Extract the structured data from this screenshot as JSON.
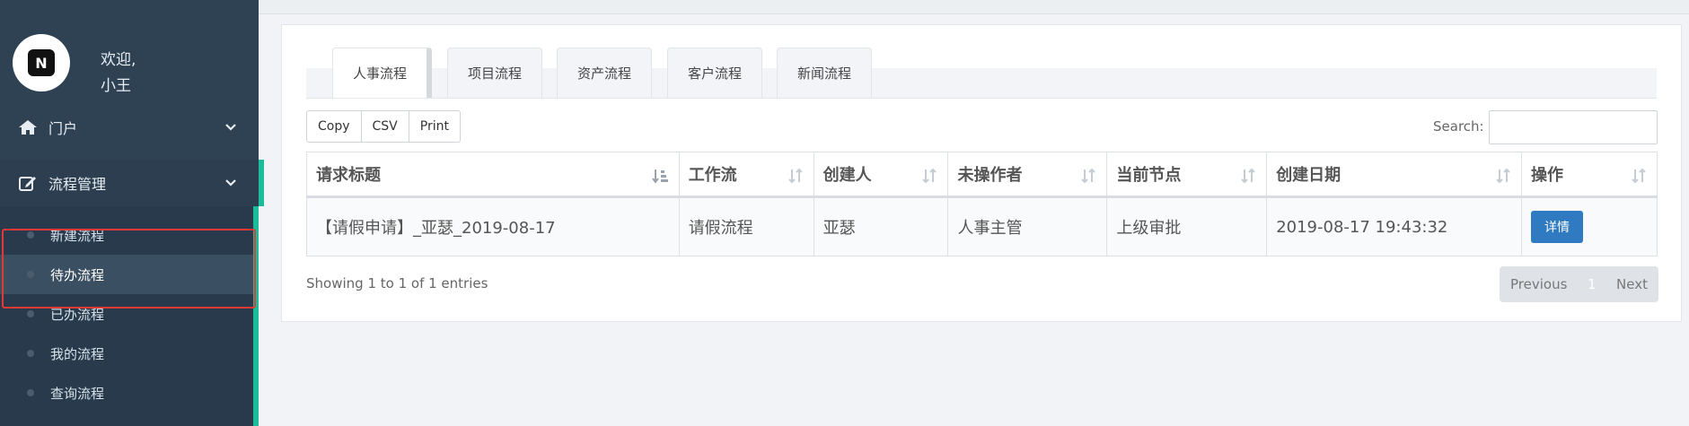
{
  "sidebar": {
    "welcome": "欢迎,",
    "username": "小王",
    "avatar_letter": "N",
    "portal": {
      "label": "门户",
      "icon": "home-icon"
    },
    "flow_mgmt": {
      "label": "流程管理",
      "icon": "edit-icon"
    },
    "sub_items": [
      {
        "label": "新建流程"
      },
      {
        "label": "待办流程",
        "active": true
      },
      {
        "label": "已办流程"
      },
      {
        "label": "我的流程"
      },
      {
        "label": "查询流程"
      }
    ]
  },
  "tabs": [
    {
      "label": "人事流程",
      "active": true
    },
    {
      "label": "项目流程"
    },
    {
      "label": "资产流程"
    },
    {
      "label": "客户流程"
    },
    {
      "label": "新闻流程"
    }
  ],
  "export_buttons": [
    "Copy",
    "CSV",
    "Print"
  ],
  "search": {
    "label": "Search:",
    "value": ""
  },
  "table": {
    "columns": [
      "请求标题",
      "工作流",
      "创建人",
      "未操作者",
      "当前节点",
      "创建日期",
      "操作"
    ],
    "rows": [
      {
        "title": "【请假申请】_亚瑟_2019-08-17",
        "workflow": "请假流程",
        "creator": "亚瑟",
        "pending": "人事主管",
        "node": "上级审批",
        "date": "2019-08-17 19:43:32",
        "action": "详情"
      }
    ]
  },
  "info": "Showing 1 to 1 of 1 entries",
  "pagination": {
    "previous": "Previous",
    "page": "1",
    "next": "Next"
  },
  "colors": {
    "sidebar_bg": "#2f4254",
    "accent": "#1abc9c",
    "primary_btn": "#2f7ac0",
    "highlight": "#e53935"
  }
}
